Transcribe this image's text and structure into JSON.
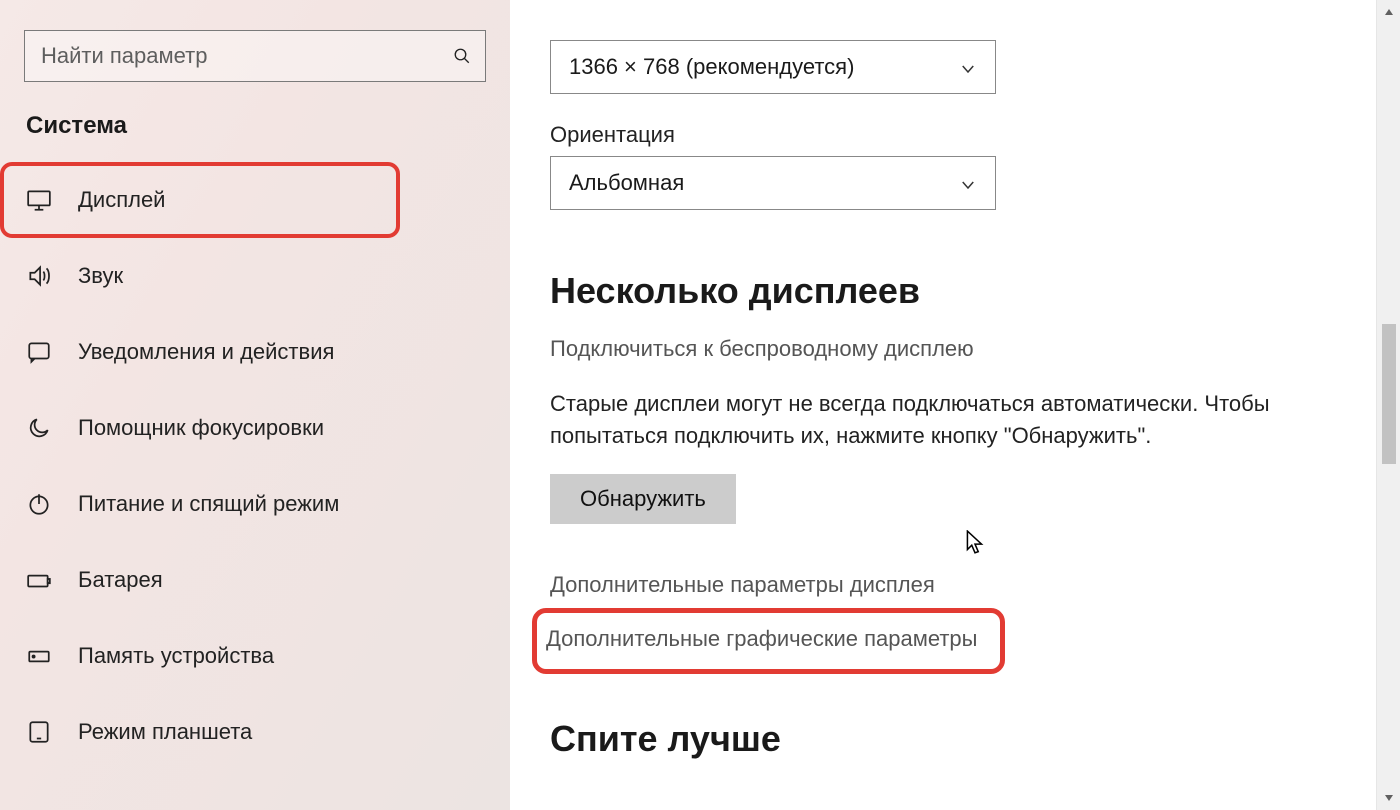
{
  "sidebar": {
    "search_placeholder": "Найти параметр",
    "section": "Система",
    "items": [
      {
        "label": "Дисплей",
        "icon": "monitor-icon",
        "highlighted": true
      },
      {
        "label": "Звук",
        "icon": "sound-icon"
      },
      {
        "label": "Уведомления и действия",
        "icon": "notifications-icon"
      },
      {
        "label": "Помощник фокусировки",
        "icon": "moon-icon"
      },
      {
        "label": "Питание и спящий режим",
        "icon": "power-icon"
      },
      {
        "label": "Батарея",
        "icon": "battery-icon"
      },
      {
        "label": "Память устройства",
        "icon": "storage-icon"
      },
      {
        "label": "Режим планшета",
        "icon": "tablet-icon"
      }
    ]
  },
  "main": {
    "resolution_value": "1366 × 768 (рекомендуется)",
    "orientation_label": "Ориентация",
    "orientation_value": "Альбомная",
    "multi_heading": "Несколько дисплеев",
    "wireless_link": "Подключиться к беспроводному дисплею",
    "detect_hint": "Старые дисплеи могут не всегда подключаться автоматически. Чтобы попытаться подключить их, нажмите кнопку \"Обнаружить\".",
    "detect_btn": "Обнаружить",
    "adv_display_link": "Дополнительные параметры дисплея",
    "adv_graphics_link": "Дополнительные графические параметры",
    "sleep_heading": "Спите лучше"
  }
}
